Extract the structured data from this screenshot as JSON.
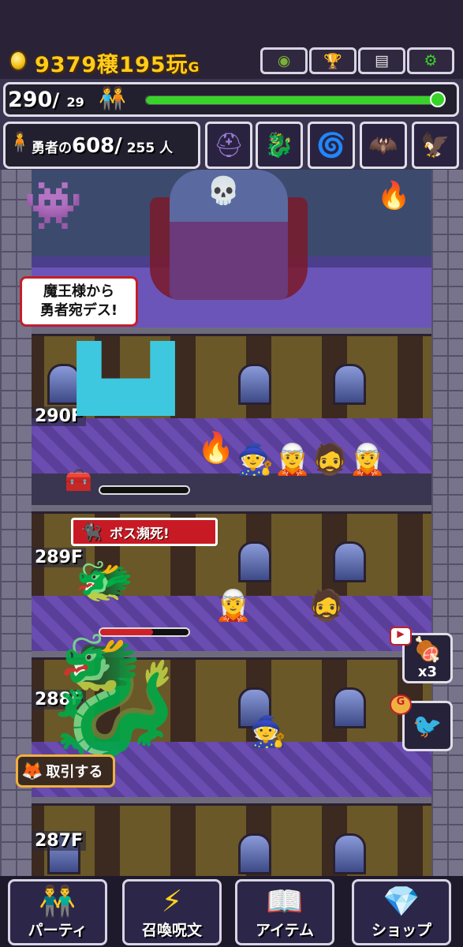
{
  "hud": {
    "currency_main": "9379",
    "currency_unit1": "穣",
    "currency_second": "195",
    "currency_unit2": "玩",
    "currency_suffix": "G",
    "buttons": [
      "globe-icon",
      "trophy-icon",
      "document-icon",
      "gear-icon"
    ]
  },
  "floor_progress": {
    "current": "290",
    "max": "29",
    "progress": 1.0,
    "bar_color": "#39d22a"
  },
  "heroes": {
    "label": "勇者の",
    "count": "608",
    "max": "255",
    "unit": "人"
  },
  "monsters": [
    "knight-monster-icon",
    "dragon-monster-icon",
    "serpent-monster-icon",
    "succubus-monster-icon",
    "eagle-monster-icon"
  ],
  "throne": {
    "speech_line1": "魔王様から",
    "speech_line2": "勇者宛デス!"
  },
  "floors": [
    {
      "label": "290F",
      "boss_hp": 0.0
    },
    {
      "label": "289F",
      "boss_hp": 0.6,
      "banner": "ボス瀕死!"
    },
    {
      "label": "288F"
    },
    {
      "label": "287F"
    }
  ],
  "side_buttons": {
    "meat_multiplier": "x3"
  },
  "trade_button": "取引する",
  "menu": [
    {
      "label": "パーティ"
    },
    {
      "label": "召喚呪文"
    },
    {
      "label": "アイテム"
    },
    {
      "label": "ショップ"
    }
  ]
}
